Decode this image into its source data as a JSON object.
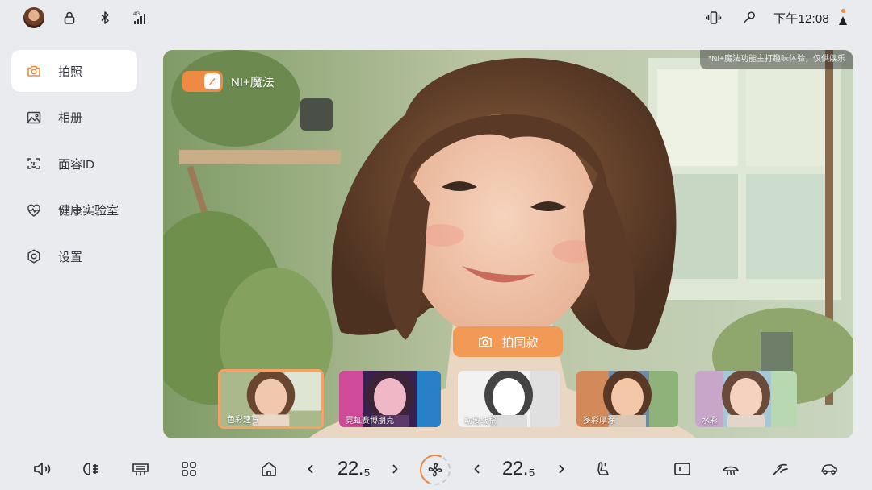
{
  "status_bar": {
    "icons": [
      "avatar",
      "lock-icon",
      "bluetooth-icon",
      "signal-4g-icon",
      "vibrate-icon",
      "microphone-off-icon"
    ],
    "time": "下午12:08"
  },
  "sidebar": {
    "items": [
      {
        "label": "拍照",
        "icon": "camera-icon",
        "active": true
      },
      {
        "label": "相册",
        "icon": "gallery-icon",
        "active": false
      },
      {
        "label": "面容ID",
        "icon": "face-id-icon",
        "active": false
      },
      {
        "label": "健康实验室",
        "icon": "heart-rate-icon",
        "active": false
      },
      {
        "label": "设置",
        "icon": "settings-icon",
        "active": false
      }
    ]
  },
  "camera": {
    "toggle_label": "NI+魔法",
    "toggle_on": true,
    "disclaimer": "*NI+魔法功能主打趣味体验，仅供娱乐",
    "same_style_button": "拍同款",
    "styles": [
      {
        "label": "色彩速写",
        "selected": true
      },
      {
        "label": "霓虹赛博朋克",
        "selected": false
      },
      {
        "label": "动漫线稿",
        "selected": false
      },
      {
        "label": "多彩厚涂",
        "selected": false
      },
      {
        "label": "水彩",
        "selected": false
      }
    ]
  },
  "dock": {
    "left_temp": {
      "whole": "22.",
      "decimal": "5"
    },
    "right_temp": {
      "whole": "22.",
      "decimal": "5"
    }
  },
  "colors": {
    "accent": "#ef8a43",
    "background": "#e9ebee",
    "card": "#ffffff"
  }
}
